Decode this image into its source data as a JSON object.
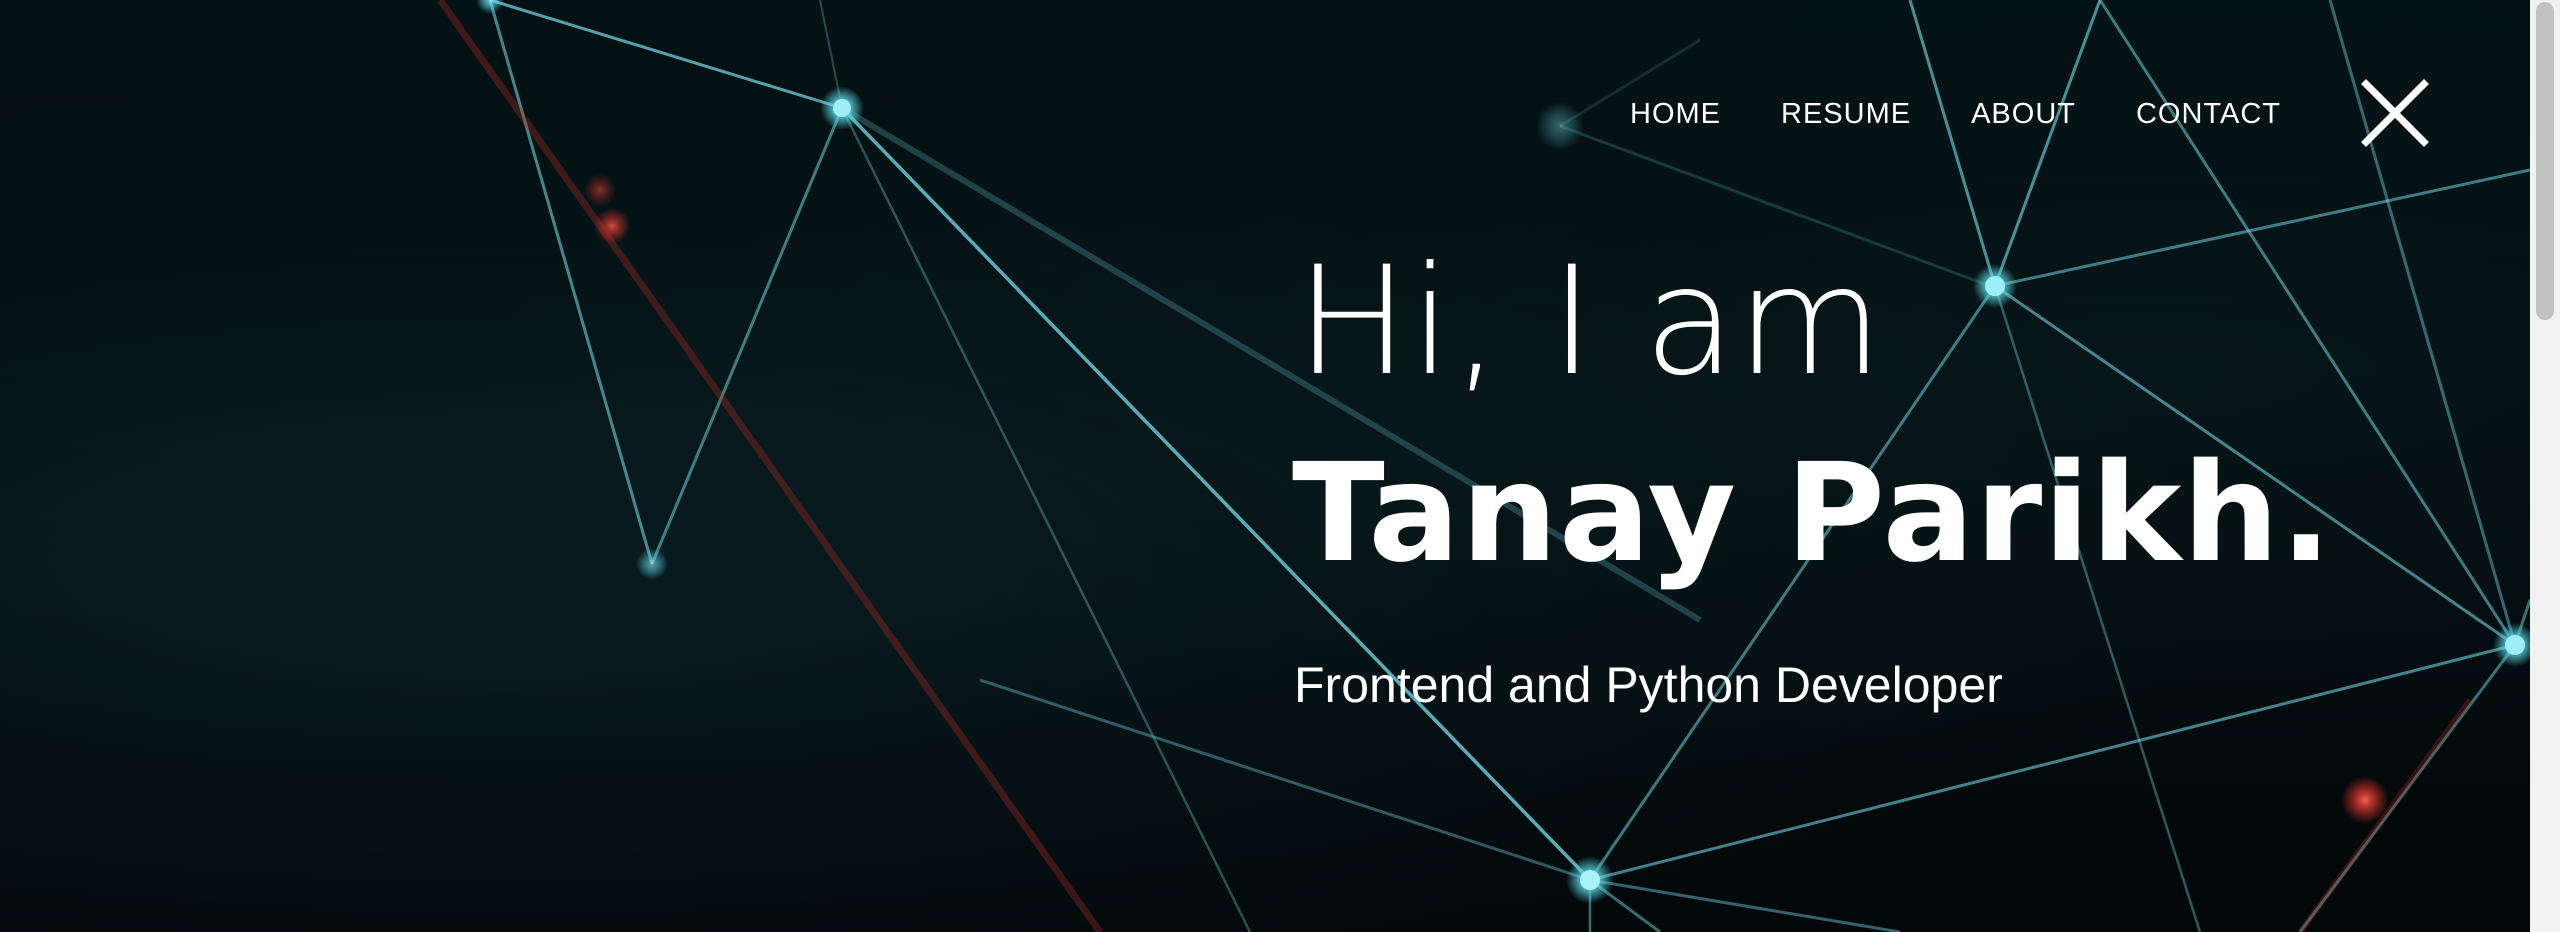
{
  "nav": {
    "items": [
      {
        "label": "HOME"
      },
      {
        "label": "RESUME"
      },
      {
        "label": "ABOUT"
      },
      {
        "label": "CONTACT"
      }
    ],
    "close_icon": "close-icon"
  },
  "hero": {
    "greeting": "Hi, I am",
    "name": "Tanay Parikh.",
    "role": "Frontend and Python Developer"
  },
  "colors": {
    "background": "#030a0c",
    "node": "#5fd8e6",
    "line": "#6fd3df",
    "accent_red": "#d8342c",
    "text": "#ffffff"
  }
}
